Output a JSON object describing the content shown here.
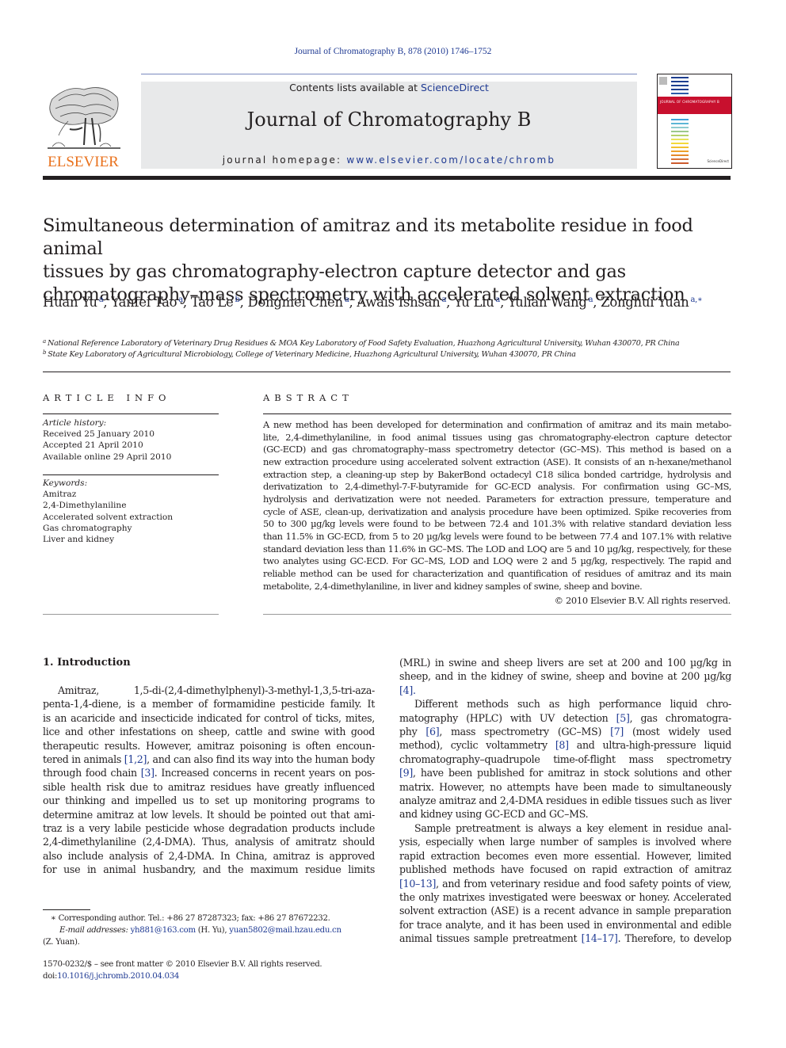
{
  "running_header": "Journal of Chromatography B, 878 (2010) 1746–1752",
  "masthead": {
    "publisher_wordmark": "ELSEVIER",
    "publisher_logo_icon": "elsevier-tree-icon",
    "contents_prefix": "Contents lists available at ",
    "contents_link": "ScienceDirect",
    "journal_title": "Journal of Chromatography B",
    "homepage_prefix": "journal homepage: ",
    "homepage_link": "www.elsevier.com/locate/chromb",
    "cover_title": "JOURNAL OF CHROMATOGRAPHY B",
    "cover_badge": "ScienceDirect",
    "colors": {
      "link": "#1f3a93",
      "elsevier_orange": "#e9711c",
      "banner_gray": "#e8e9ea",
      "cover_red": "#c8102e"
    }
  },
  "article": {
    "title_lines": [
      "Simultaneous determination of amitraz and its metabolite residue in food animal",
      "tissues by gas chromatography-electron capture detector and gas",
      "chromatography–mass spectrometry with accelerated solvent extraction"
    ],
    "authors": [
      {
        "name": "Huan Yu",
        "aff": "a"
      },
      {
        "name": "Yanfei Tao",
        "aff": "a"
      },
      {
        "name": "Tao Le",
        "aff": "b"
      },
      {
        "name": "Dongmei Chen",
        "aff": "a"
      },
      {
        "name": "Awais Ishsan",
        "aff": "a"
      },
      {
        "name": "Yu Liu",
        "aff": "a"
      },
      {
        "name": "Yulian Wang",
        "aff": "a"
      },
      {
        "name": "Zonghui Yuan",
        "aff": "a,∗"
      }
    ],
    "affiliations": [
      {
        "key": "a",
        "text": "National Reference Laboratory of Veterinary Drug Residues & MOA Key Laboratory of Food Safety Evaluation, Huazhong Agricultural University, Wuhan 430070, PR China"
      },
      {
        "key": "b",
        "text": "State Key Laboratory of Agricultural Microbiology, College of Veterinary Medicine, Huazhong Agricultural University, Wuhan 430070, PR China"
      }
    ]
  },
  "article_info": {
    "heading": "ARTICLE INFO",
    "history_label": "Article history:",
    "history": [
      "Received 25 January 2010",
      "Accepted 21 April 2010",
      "Available online 29 April 2010"
    ],
    "keywords_label": "Keywords:",
    "keywords": [
      "Amitraz",
      "2,4-Dimethylaniline",
      "Accelerated solvent extraction",
      "Gas chromatography",
      "Liver and kidney"
    ]
  },
  "abstract": {
    "heading": "ABSTRACT",
    "lines": [
      "A new method has been developed for determination and confirmation of amitraz and its main metabo-",
      "lite, 2,4-dimethylaniline, in food animal tissues using gas chromatography-electron capture detector",
      "(GC-ECD) and gas chromatography–mass spectrometry detector (GC–MS). This method is based on a",
      "new extraction procedure using accelerated solvent extraction (ASE). It consists of an n-hexane/methanol",
      "extraction step, a cleaning-up step by BakerBond octadecyl C18 silica bonded cartridge, hydrolysis and",
      "derivatization to 2,4-dimethyl-7-F-butyramide for GC-ECD analysis. For confirmation using GC–MS,",
      "hydrolysis and derivatization were not needed. Parameters for extraction pressure, temperature and",
      "cycle of ASE, clean-up, derivatization and analysis procedure have been optimized. Spike recoveries from",
      "50 to 300 µg/kg levels were found to be between 72.4 and 101.3% with relative standard deviation less",
      "than 11.5% in GC-ECD, from 5 to 20 µg/kg levels were found to be between 77.4 and 107.1% with relative",
      "standard deviation less than 11.6% in GC–MS. The LOD and LOQ are 5 and 10 µg/kg, respectively, for these",
      "two analytes using GC-ECD. For GC–MS, LOD and LOQ were 2 and 5 µg/kg, respectively. The rapid and",
      "reliable method can be used for characterization and quantification of residues of amitraz and its main",
      "metabolite, 2,4-dimethylaniline, in liver and kidney samples of swine, sheep and bovine."
    ],
    "copyright": "© 2010 Elsevier B.V. All rights reserved."
  },
  "introduction": {
    "heading": "1.  Introduction",
    "left_column_lines": [
      "Amitraz,   1,5-di-(2,4-dimethylphenyl)-3-methyl-1,3,5-tri-aza-",
      "penta-1,4-diene, is a member of formamidine pesticide family. It",
      "is an acaricide and insecticide indicated for control of ticks, mites,",
      "lice and other infestations on sheep, cattle and swine with good",
      "therapeutic results. However, amitraz poisoning is often encoun-",
      "tered in animals [1,2], and can also find its way into the human body",
      "through food chain [3]. Increased concerns in recent years on pos-",
      "sible health risk due to amitraz residues have greatly influenced",
      "our thinking and impelled us to set up monitoring programs to",
      "determine amitraz at low levels. It should be pointed out that ami-",
      "traz is a very labile pesticide whose degradation products include",
      "2,4-dimethylaniline (2,4-DMA). Thus, analysis of amitratz should",
      "also include analysis of 2,4-DMA. In China, amitraz is approved",
      "for use in animal husbandry, and the maximum residue limits"
    ],
    "right_column_lines": [
      "(MRL) in swine and sheep livers are set at 200 and 100 µg/kg in",
      "sheep, and in the kidney of swine, sheep and bovine at 200 µg/kg",
      "[4].",
      "Different methods such as high performance liquid chro-",
      "matography (HPLC) with UV detection [5], gas chromatogra-",
      "phy [6], mass spectrometry (GC–MS) [7] (most widely used",
      "method), cyclic voltammetry [8] and ultra-high-pressure liquid",
      "chromatography–quadrupole time-of-flight mass spectrometry",
      "[9], have been published for amitraz in stock solutions and other",
      "matrix. However, no attempts have been made to simultaneously",
      "analyze amitraz and 2,4-DMA residues in edible tissues such as liver",
      "and kidney using GC-ECD and GC–MS.",
      "Sample pretreatment is always a key element in residue anal-",
      "ysis, especially when large number of samples is involved where",
      "rapid extraction becomes even more essential. However, limited",
      "published methods have focused on rapid extraction of amitraz",
      "[10–13], and from veterinary residue and food safety points of view,",
      "the only matrixes investigated were beeswax or honey. Accelerated",
      "solvent extraction (ASE) is a recent advance in sample preparation",
      "for trace analyte, and it has been used in environmental and edible",
      "animal tissues sample pretreatment [14–17]. Therefore, to develop"
    ]
  },
  "footnotes": {
    "corresponding": "∗  Corresponding author. Tel.: +86 27 87287323; fax: +86 27 87672232.",
    "email_label": "E-mail addresses:",
    "email1": "yh881@163.com",
    "email1_who": " (H. Yu), ",
    "email2": "yuan5802@mail.hzau.edu.cn",
    "email2_who": "(Z. Yuan).",
    "issn_line": "1570-0232/$ – see front matter © 2010 Elsevier B.V. All rights reserved.",
    "doi_prefix": "doi:",
    "doi": "10.1016/j.jchromb.2010.04.034"
  }
}
